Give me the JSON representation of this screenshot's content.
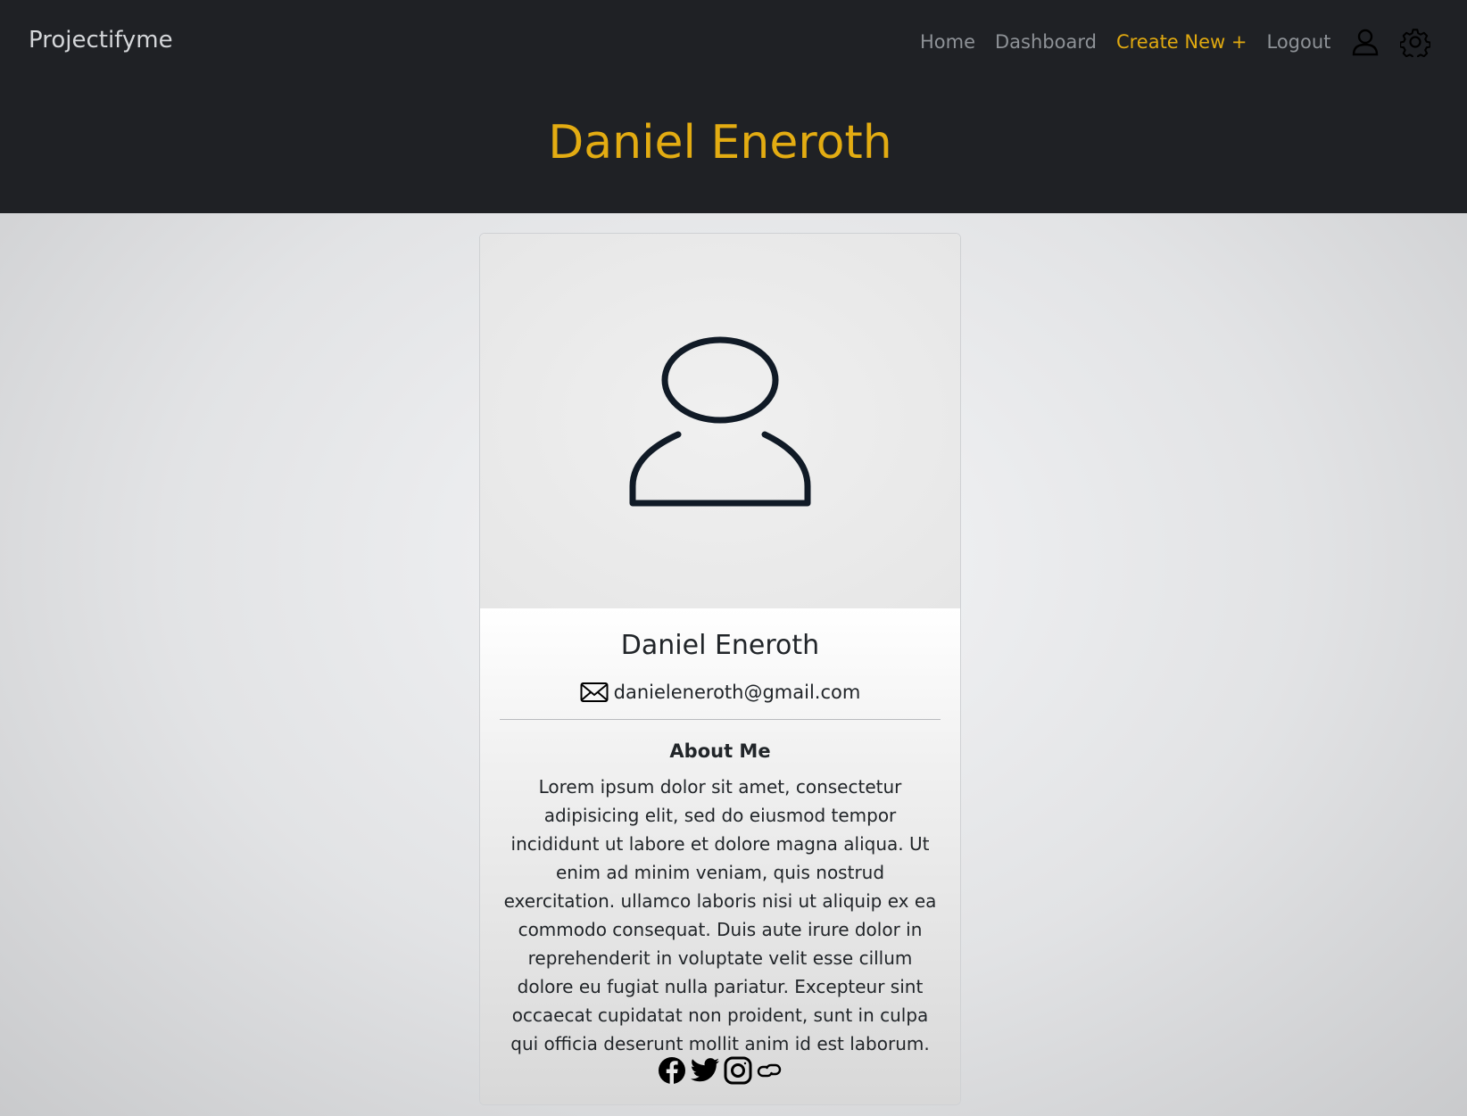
{
  "nav": {
    "brand": "Projectifyme",
    "links": [
      "Home",
      "Dashboard",
      "Create New +",
      "Logout"
    ]
  },
  "hero": {
    "title": "Daniel Eneroth"
  },
  "profile": {
    "name": "Daniel Eneroth",
    "email": "danieleneroth@gmail.com",
    "about_title": "About Me",
    "about_text": "Lorem ipsum dolor sit amet, consectetur adipisicing elit, sed do eiusmod tempor incididunt ut labore et dolore magna aliqua. Ut enim ad minim veniam, quis nostrud exercitation. ullamco laboris nisi ut aliquip ex ea commodo consequat. Duis aute irure dolor in reprehenderit in voluptate velit esse cillum dolore eu fugiat nulla pariatur. Excepteur sint occaecat cupidatat non proident, sunt in culpa qui officia deserunt mollit anim id est laborum."
  },
  "icons": {
    "avatar": "person-icon",
    "email": "envelope-icon",
    "social": [
      "facebook-icon",
      "twitter-icon",
      "instagram-icon",
      "link-icon"
    ],
    "nav": [
      "user-icon",
      "gear-icon"
    ]
  },
  "colors": {
    "accent": "#e3ac12",
    "header_bg": "#1f2125",
    "nav_link": "#8e9297"
  }
}
